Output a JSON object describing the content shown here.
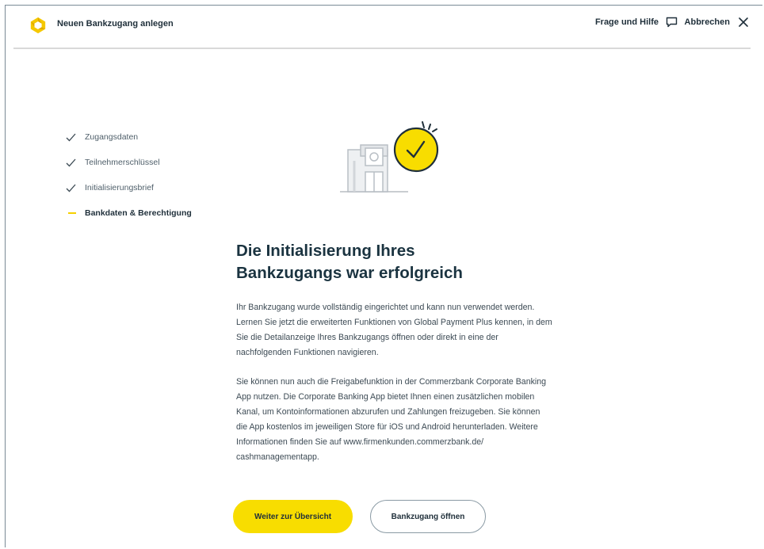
{
  "header": {
    "title": "Neuen Bankzugang anlegen",
    "help_label": "Frage und Hilfe",
    "cancel_label": "Abbrechen"
  },
  "steps": [
    {
      "label": "Zugangsdaten",
      "state": "done"
    },
    {
      "label": "Teilnehmerschlüssel",
      "state": "done"
    },
    {
      "label": "Initialisierungsbrief",
      "state": "done"
    },
    {
      "label": "Bankdaten & Berechtigung",
      "state": "active"
    }
  ],
  "main": {
    "headline": "Die Initialisierung Ihres Bankzugangs war erfolgreich",
    "paragraph1": "Ihr Bankzugang wurde vollständig eingerichtet und kann nun verwendet werden. Lernen Sie jetzt die erweiterten Funktionen von Global Payment Plus kennen, in dem Sie die Detailanzeige Ihres Bankzugangs öffnen oder direkt in eine der nachfolgenden Funktionen navigieren.",
    "paragraph2": "Sie können nun auch die Freigabefunktion in der Commerzbank Corporate Banking App nutzen. Die Corporate Banking App bietet Ihnen einen zusätzlichen mobilen Kanal, um Kontoinformationen abzurufen und Zahlungen freizugeben. Sie können die App kostenlos im jeweiligen Store für iOS und Android herunterladen. Weitere Informationen finden Sie auf www.firmenkunden.commerzbank.de/ cashmanagementapp.",
    "primary_button": "Weiter zur Übersicht",
    "secondary_button": "Bankzugang öffnen"
  },
  "colors": {
    "accent": "#f8dd00",
    "text": "#1f2f3a",
    "divider": "#d9d9d9"
  },
  "icons": {
    "logo": "commerzbank-logo-icon",
    "help": "chat-bubble-icon",
    "cancel": "close-icon",
    "step_done": "checkmark-icon",
    "illustration": "bank-building-success-icon"
  }
}
